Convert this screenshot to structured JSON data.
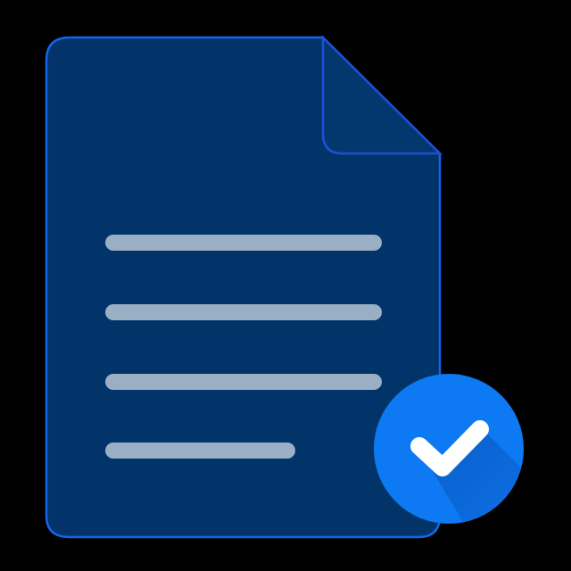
{
  "icon": {
    "name": "document-verified-icon",
    "document": {
      "name": "document-icon",
      "text_line_count": 4
    },
    "badge": {
      "name": "checkmark-badge-icon"
    }
  },
  "colors": {
    "background": "#000000",
    "document_fill": "#02346A",
    "document_outline": "#1466E8",
    "fold_fill": "#03386F",
    "text_lines": "#9AAEC4",
    "badge_fill": "#0D79F2",
    "badge_shadow": "#0A5CC6",
    "checkmark": "#FFFFFF"
  }
}
